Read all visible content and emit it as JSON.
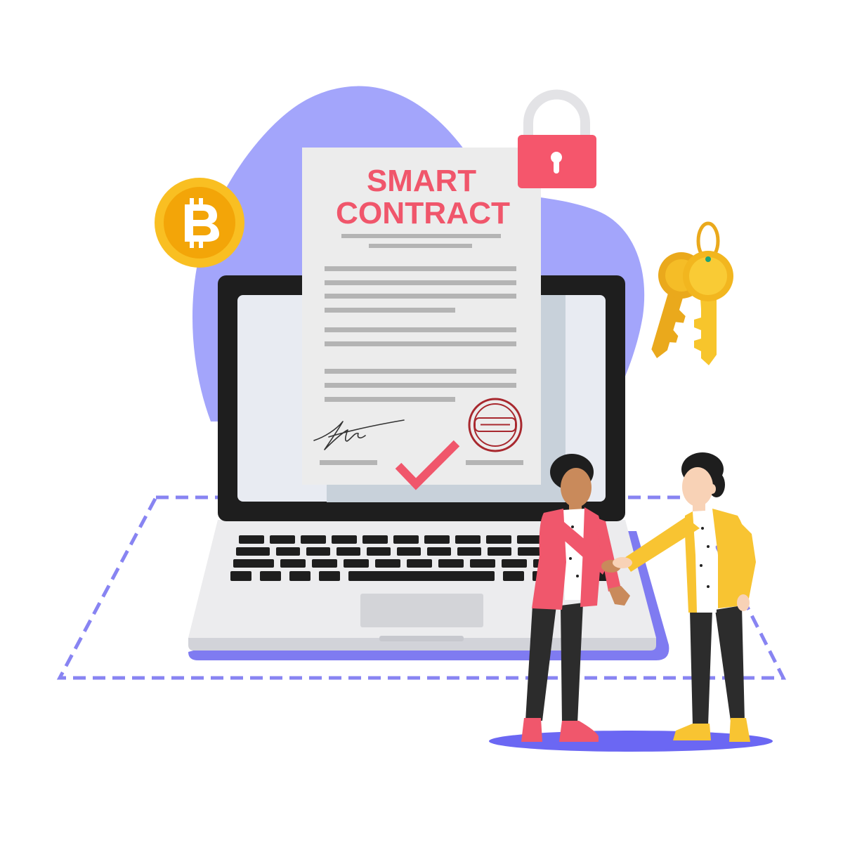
{
  "document": {
    "title_line1": "SMART",
    "title_line2": "CONTRACT"
  },
  "icons": {
    "coin": "bitcoin-icon",
    "lock": "padlock-icon",
    "keys": "keys-icon",
    "check": "checkmark-icon",
    "stamp": "stamp-icon",
    "signature": "signature-icon",
    "laptop": "laptop-icon"
  },
  "colors": {
    "accent": "#f0566b",
    "blob": "#a3a5fb",
    "platform": "#8884f2",
    "floor_shadow": "#6b67f3",
    "laptop_shadow": "#7f7bf1",
    "laptop_body": "#ececee",
    "laptop_frame": "#1e1e1e",
    "screen": "#e8ebf2",
    "coin_outer": "#f9bf22",
    "coin_inner": "#f3a508",
    "key_gold": "#f7c52c",
    "key_dark": "#eaa91c",
    "lock_body": "#f5566c",
    "lock_shackle": "#e3e3e6",
    "paper": "#ececec",
    "paper_back": "#c8d1da",
    "text_lines": "#b4b4b4",
    "stamp": "#a8282e",
    "jacket_pink": "#f0576c",
    "jacket_yellow": "#f8c432",
    "pants": "#2c2c2c",
    "hair": "#1e1e1e",
    "skin_dark": "#c98a5b",
    "skin_light": "#f8d2b6"
  }
}
